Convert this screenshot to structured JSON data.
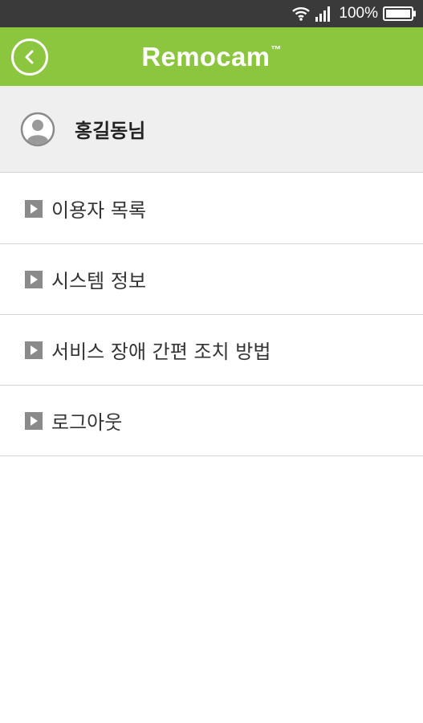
{
  "status_bar": {
    "battery_text": "100%",
    "icons": [
      "wifi-icon",
      "signal-icon",
      "battery-icon"
    ]
  },
  "app_bar": {
    "title": "Remocam",
    "trademark": "™",
    "back_icon": "chevron-left-icon",
    "color": "#8cc63e"
  },
  "profile": {
    "avatar_icon": "user-avatar-icon",
    "name": "홍길동님"
  },
  "menu": {
    "item_icon": "play-icon",
    "items": [
      {
        "label": "이용자 목록"
      },
      {
        "label": "시스템 정보"
      },
      {
        "label": "서비스 장애 간편 조치 방법"
      },
      {
        "label": "로그아웃"
      }
    ]
  }
}
